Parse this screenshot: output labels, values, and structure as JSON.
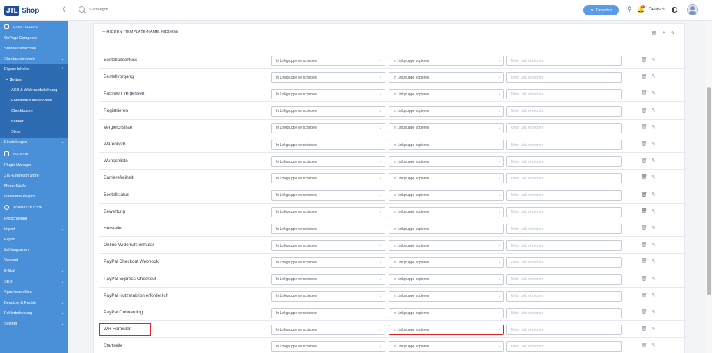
{
  "header": {
    "logo_box": "JTL",
    "logo_text": "Shop",
    "search_placeholder": "Suchbegriff",
    "favorites_label": "Favoriten",
    "notification_count": "1",
    "language": "Deutsch"
  },
  "sidebar": {
    "sections": [
      {
        "label": "DARSTELLUNG"
      },
      {
        "label": "PLUGINS"
      },
      {
        "label": "ADMINISTRATION"
      }
    ],
    "darstellung": [
      "OnPage Composer",
      "Standardansichten",
      "Standardelemente",
      "Eigene Inhalte"
    ],
    "eigene_inhalte_sub": [
      "Seiten",
      "AGB & Widerrufsbelehrung",
      "Erweiterte Kundendaten",
      "Checkboxen",
      "Banner",
      "Slider"
    ],
    "after_sub": [
      "Einstellungen"
    ],
    "plugins": [
      "Plugin-Manager",
      "JTL-Extension Store",
      "Meine Käufe",
      "Installierte Plugins"
    ],
    "administration": [
      "Freischaltung",
      "Import",
      "Export",
      "Zahlungsarten",
      "Versand",
      "E-Mail",
      "SEO",
      "Sprachvariablen",
      "Benutzer & Rechte",
      "Fehlerbehebung",
      "System"
    ]
  },
  "main": {
    "section_title": "— HIDDEN (TEMPLATE-NAME: HIDDEN)",
    "move_placeholder": "In Linkgruppe verschieben",
    "copy_placeholder": "In Linkgruppe kopieren",
    "link_placeholder": "Unter Link einordnen",
    "rows": [
      "Bestellabschluss",
      "Bestellvorgang",
      "Passwort vergessen",
      "Registrieren",
      "Vergleichsliste",
      "Warenkorb",
      "Wunschliste",
      "Barrierefreiheit",
      "Bestellstatus",
      "Bewertung",
      "Hersteller",
      "Online-Widerrufsformular",
      "PayPal Checkout Webhook",
      "PayPal Express-Checkout",
      "PayPal Nutzeraktion erforderlich",
      "PayPal Onboarding",
      "WR-Formular",
      "Startseite"
    ]
  },
  "colors": {
    "sidebar": "#4a90d9",
    "sidebar_active": "#2d6bb3",
    "highlight": "#e02424",
    "favorites": "#5b9be6"
  }
}
